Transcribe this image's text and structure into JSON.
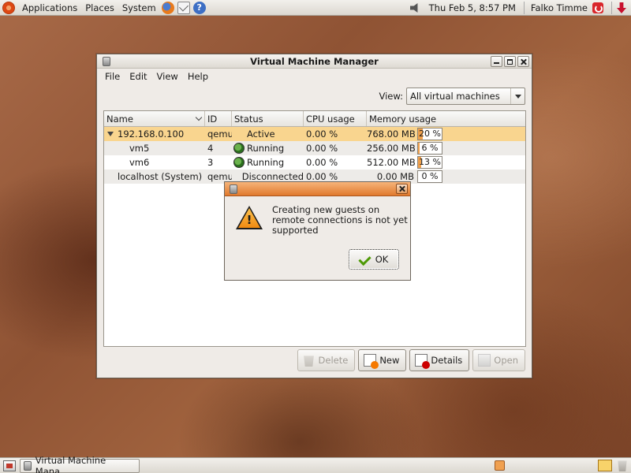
{
  "top_panel": {
    "menus": [
      "Applications",
      "Places",
      "System"
    ],
    "clock": "Thu Feb  5,  8:57 PM",
    "user": "Falko Timme"
  },
  "window": {
    "title": "Virtual Machine Manager",
    "menu": [
      "File",
      "Edit",
      "View",
      "Help"
    ],
    "view_label": "View:",
    "view_value": "All virtual machines",
    "columns": [
      "Name",
      "ID",
      "Status",
      "CPU usage",
      "Memory usage"
    ],
    "rows": [
      {
        "name": "192.168.0.100",
        "id": "qemu",
        "status": "Active",
        "cpu": "0.00 %",
        "mem": "768.00 MB",
        "mem_pct": "20 %",
        "mem_frac": 0.2
      },
      {
        "name": "vm5",
        "id": "4",
        "status": "Running",
        "cpu": "0.00 %",
        "mem": "256.00 MB",
        "mem_pct": "6 %",
        "mem_frac": 0.06
      },
      {
        "name": "vm6",
        "id": "3",
        "status": "Running",
        "cpu": "0.00 %",
        "mem": "512.00 MB",
        "mem_pct": "13 %",
        "mem_frac": 0.13
      },
      {
        "name": "localhost (System)",
        "id": "qemu",
        "status": "Disconnected",
        "cpu": "0.00 %",
        "mem": "0.00 MB",
        "mem_pct": "0 %",
        "mem_frac": 0
      }
    ],
    "buttons": {
      "delete": "Delete",
      "new": "New",
      "details": "Details",
      "open": "Open"
    }
  },
  "dialog": {
    "message": "Creating new guests on remote connections is not yet supported",
    "ok": "OK"
  },
  "taskbar": {
    "task_title": "Virtual Machine Mana..."
  },
  "colors": {
    "selection": "#f9d58f",
    "dialog_titlebar": "#e0792d",
    "accent": "#f0a04b"
  }
}
